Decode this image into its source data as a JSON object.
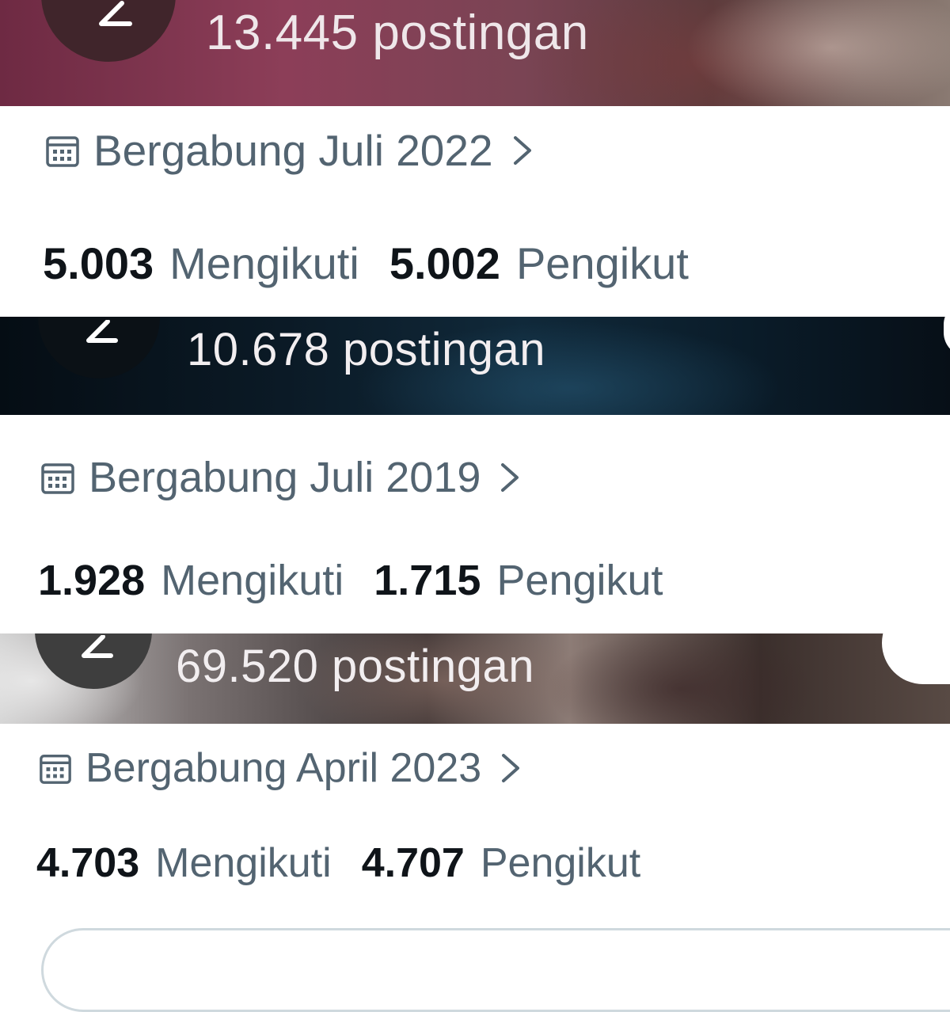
{
  "profiles": [
    {
      "post_count": "13.445 postingan",
      "joined": "Bergabung Juli 2022",
      "following_count": "5.003",
      "following_label": "Mengikuti",
      "followers_count": "5.002",
      "followers_label": "Pengikut"
    },
    {
      "post_count": "10.678 postingan",
      "joined": "Bergabung Juli 2019",
      "following_count": "1.928",
      "following_label": "Mengikuti",
      "followers_count": "1.715",
      "followers_label": "Pengikut"
    },
    {
      "post_count": "69.520 postingan",
      "joined": "Bergabung April 2023",
      "following_count": "4.703",
      "following_label": "Mengikuti",
      "followers_count": "4.707",
      "followers_label": "Pengikut"
    }
  ],
  "icons": {
    "back": "back-arrow-icon",
    "calendar": "calendar-icon",
    "chevron": "chevron-right-icon"
  },
  "colors": {
    "primary_text": "#0f1419",
    "secondary_text": "#536471",
    "background": "#ffffff"
  }
}
